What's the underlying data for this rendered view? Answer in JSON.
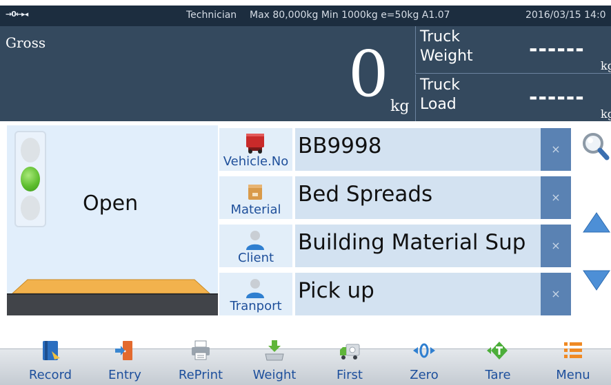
{
  "status_bar": {
    "zero_indicator": "→0←▸◂",
    "role": "Technician",
    "capacity": "Max 80,000kg  Min 1000kg  e=50kg  A1.07",
    "datetime": "2016/03/15  14:0"
  },
  "gross": {
    "label": "Gross",
    "value": "0",
    "unit": "kg"
  },
  "truck_weight": {
    "label_line1": "Truck",
    "label_line2": "Weight",
    "value": "------",
    "unit": "kg"
  },
  "truck_load": {
    "label_line1": "Truck",
    "label_line2": "Load",
    "value": "------",
    "unit": "kg"
  },
  "traffic_light": {
    "status": "Open",
    "active_lamp": "green"
  },
  "fields": {
    "vehicle": {
      "label": "Vehicle.No",
      "value": "BB9998",
      "icon": "red-truck-icon"
    },
    "material": {
      "label": "Material",
      "value": "Bed Spreads",
      "icon": "box-icon"
    },
    "client": {
      "label": "Client",
      "value": "Building Material Sup",
      "icon": "person-icon"
    },
    "transport": {
      "label": "Tranport",
      "value": "Pick up",
      "icon": "person-icon"
    },
    "clear_symbol": "×"
  },
  "toolbar": {
    "record": "Record",
    "entry": "Entry",
    "reprint": "RePrint",
    "weight": "Weight",
    "first": "First",
    "zero": "Zero",
    "tare": "Tare",
    "menu": "Menu"
  },
  "colors": {
    "status_bar": "#1c2d3f",
    "display_panel": "#34495e",
    "accent_blue": "#5a82b3",
    "label_blue": "#1e4f9a",
    "go_green": "#5fbe2f"
  }
}
